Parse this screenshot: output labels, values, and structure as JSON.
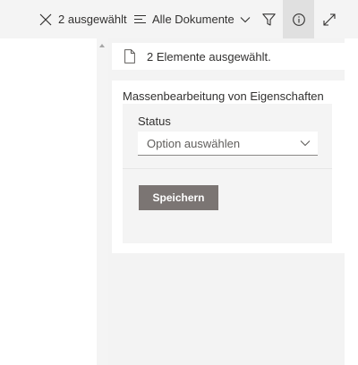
{
  "command_bar": {
    "selection_count_label": "2 ausgewählt",
    "view_label": "Alle Dokumente",
    "icons": [
      "close-icon",
      "view-list-icon",
      "chevron-down-icon",
      "filter-icon",
      "info-icon",
      "expand-icon"
    ]
  },
  "details_panel": {
    "selection_summary": "2 Elemente ausgewählt.",
    "bulk_edit_title": "Massenbearbeitung von Eigenschaften",
    "status_field": {
      "label": "Status",
      "placeholder": "Option auswählen"
    },
    "save_label": "Speichern"
  },
  "colors": {
    "command_bar_bg": "#f4f4f4",
    "active_button_bg": "#e0e0e0",
    "save_button_bg": "#7b7573"
  }
}
